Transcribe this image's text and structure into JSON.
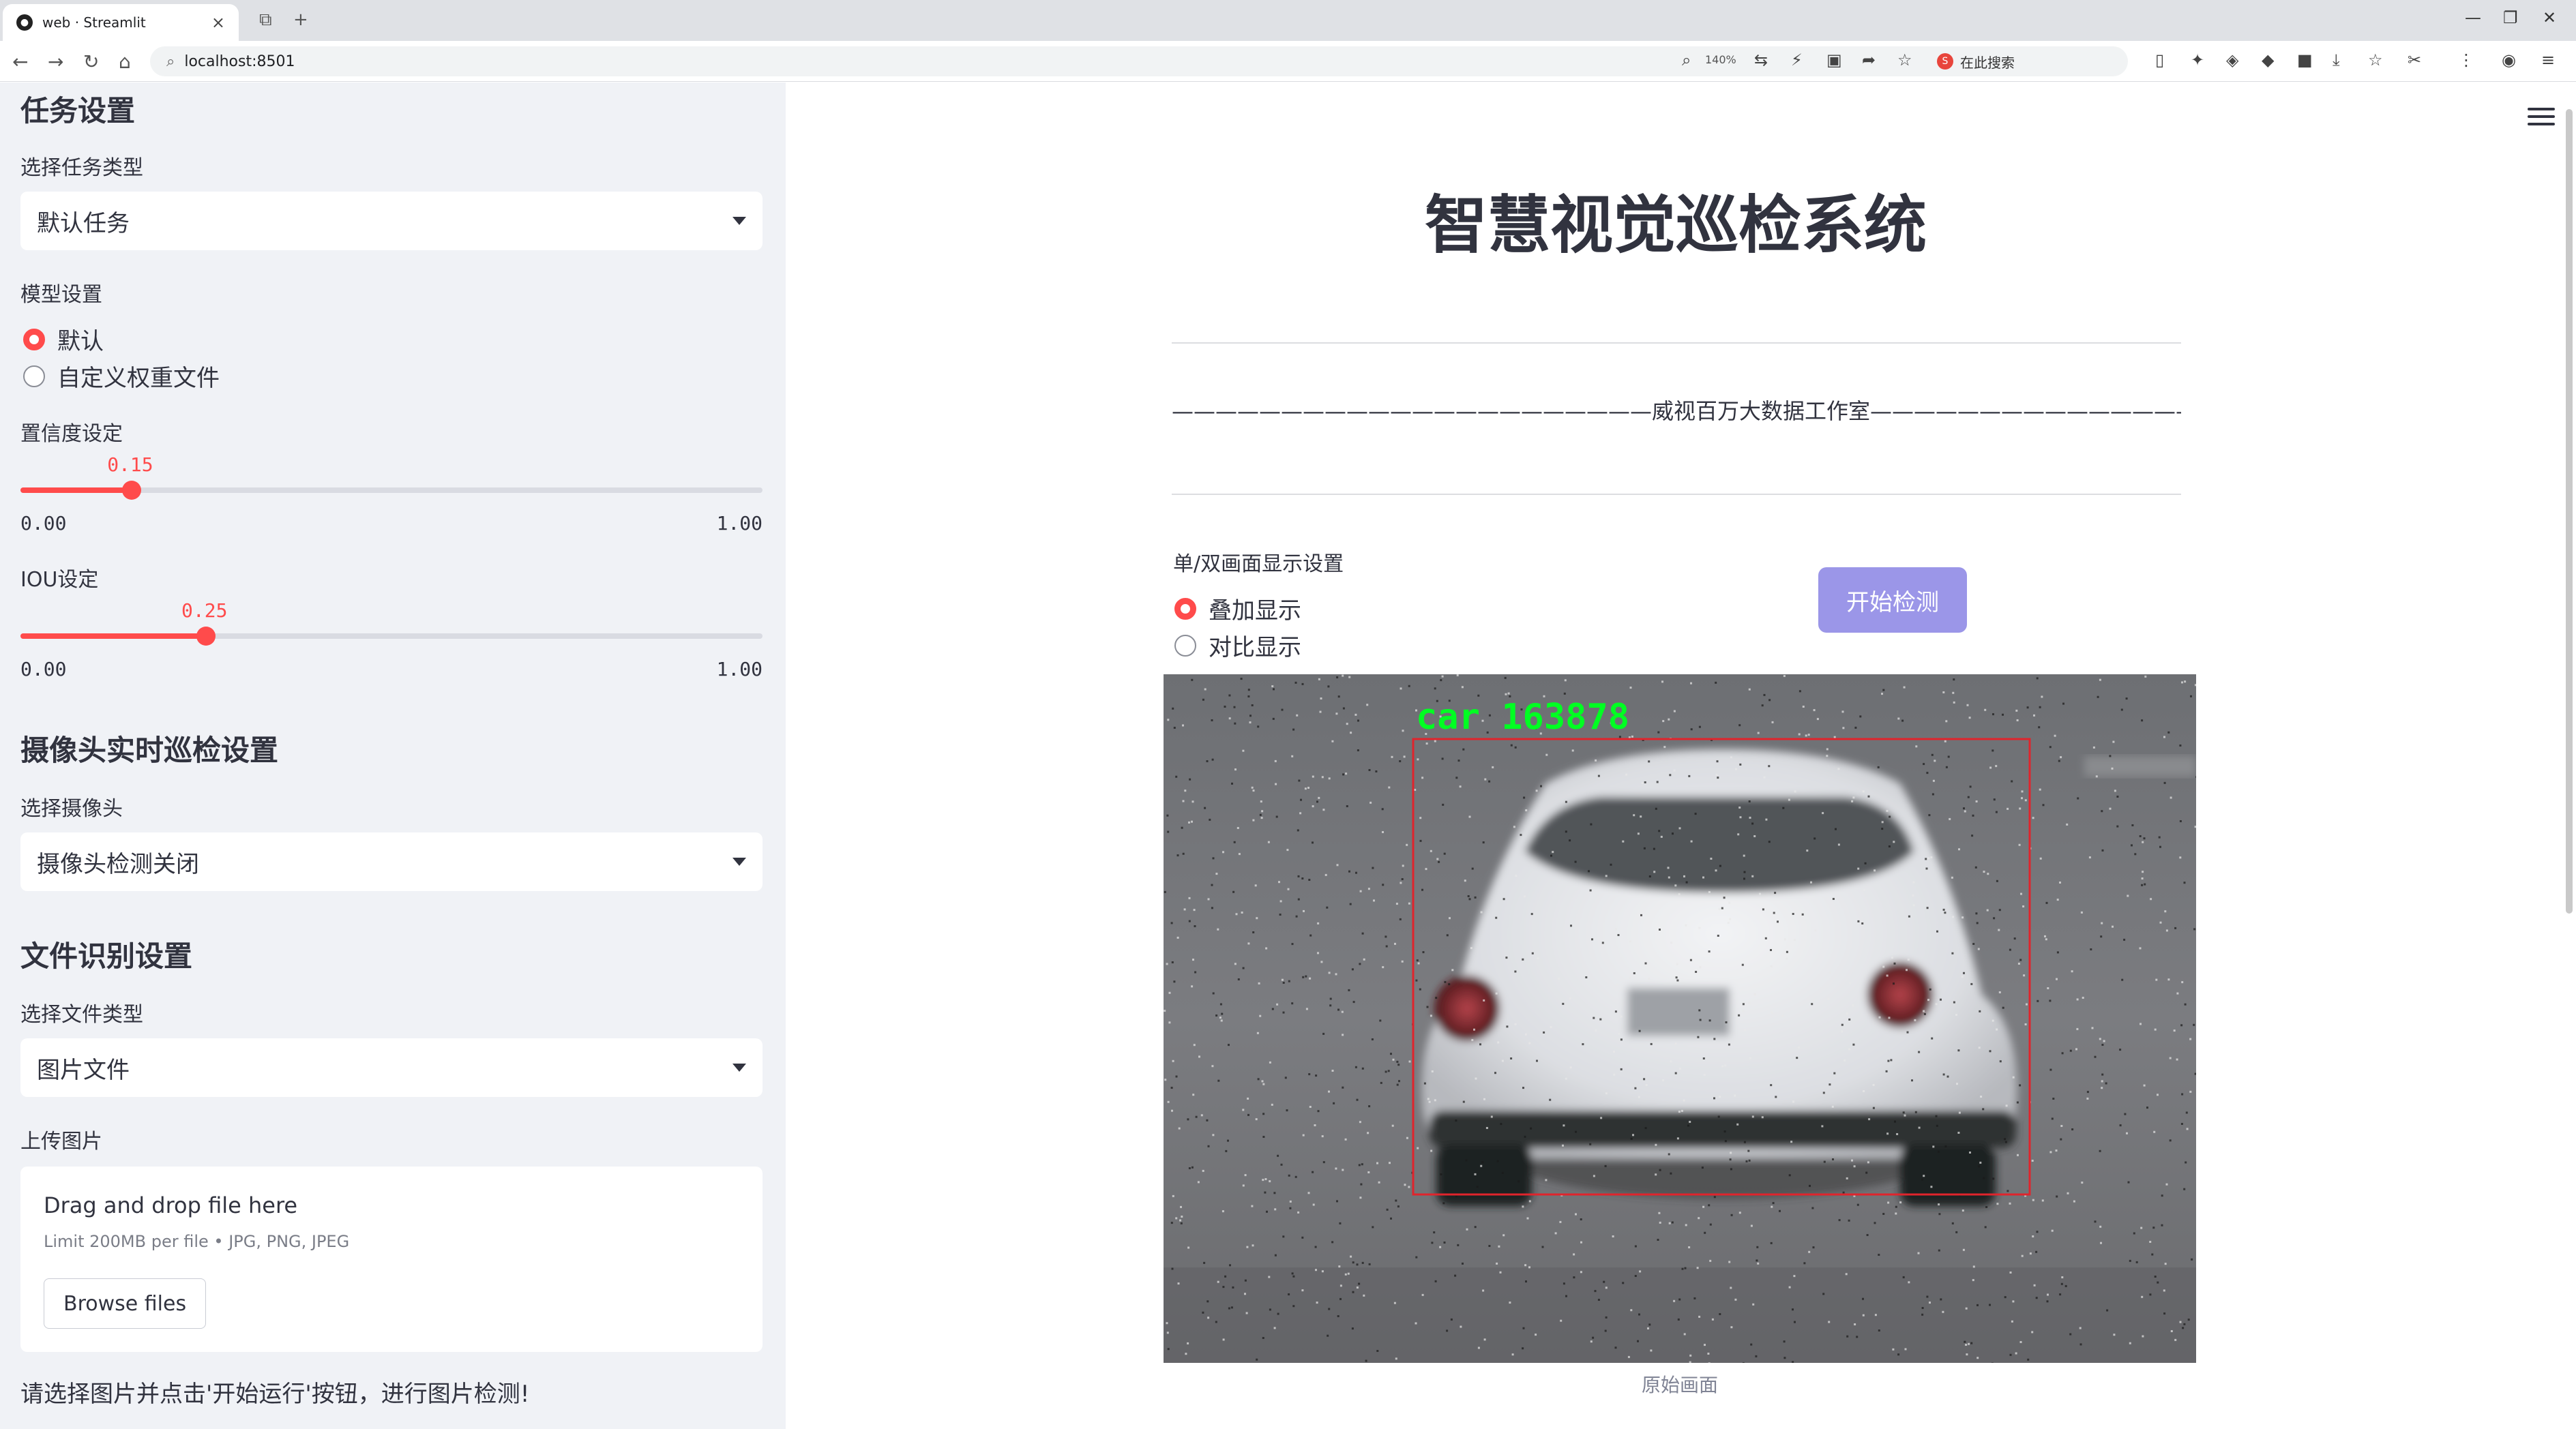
{
  "browser": {
    "tab_title": "web · Streamlit",
    "url": "localhost:8501",
    "zoom": "140%",
    "search_label": "在此搜索"
  },
  "sidebar": {
    "task_heading": "任务设置",
    "task_type_label": "选择任务类型",
    "task_type_value": "默认任务",
    "model_label": "模型设置",
    "model_options": [
      "默认",
      "自定义权重文件"
    ],
    "model_selected": 0,
    "conf_label": "置信度设定",
    "conf": {
      "value": 0.15,
      "value_text": "0.15",
      "min": "0.00",
      "max": "1.00"
    },
    "iou_label": "IOU设定",
    "iou": {
      "value": 0.25,
      "value_text": "0.25",
      "min": "0.00",
      "max": "1.00"
    },
    "camera_heading": "摄像头实时巡检设置",
    "camera_label": "选择摄像头",
    "camera_value": "摄像头检测关闭",
    "file_heading": "文件识别设置",
    "file_type_label": "选择文件类型",
    "file_type_value": "图片文件",
    "upload_label": "上传图片",
    "upload_title": "Drag and drop file here",
    "upload_limit": "Limit 200MB per file • JPG, PNG, JPEG",
    "browse_label": "Browse files",
    "note": "请选择图片并点击'开始运行'按钮，进行图片检测!"
  },
  "main": {
    "title": "智慧视觉巡检系统",
    "subline": "——————————————————————威视百万大数据工作室———————————————————————",
    "display_label": "单/双画面显示设置",
    "display_options": [
      "叠加显示",
      "对比显示"
    ],
    "display_selected": 0,
    "start_button": "开始检测",
    "detection_label": "car 163878",
    "caption": "原始画面"
  },
  "colors": {
    "accent": "#ff4b4b",
    "sidebar_bg": "#f0f2f6",
    "button_bg": "#9b96e8",
    "detection_box": "#e0242c",
    "detection_text": "#00ff22"
  }
}
